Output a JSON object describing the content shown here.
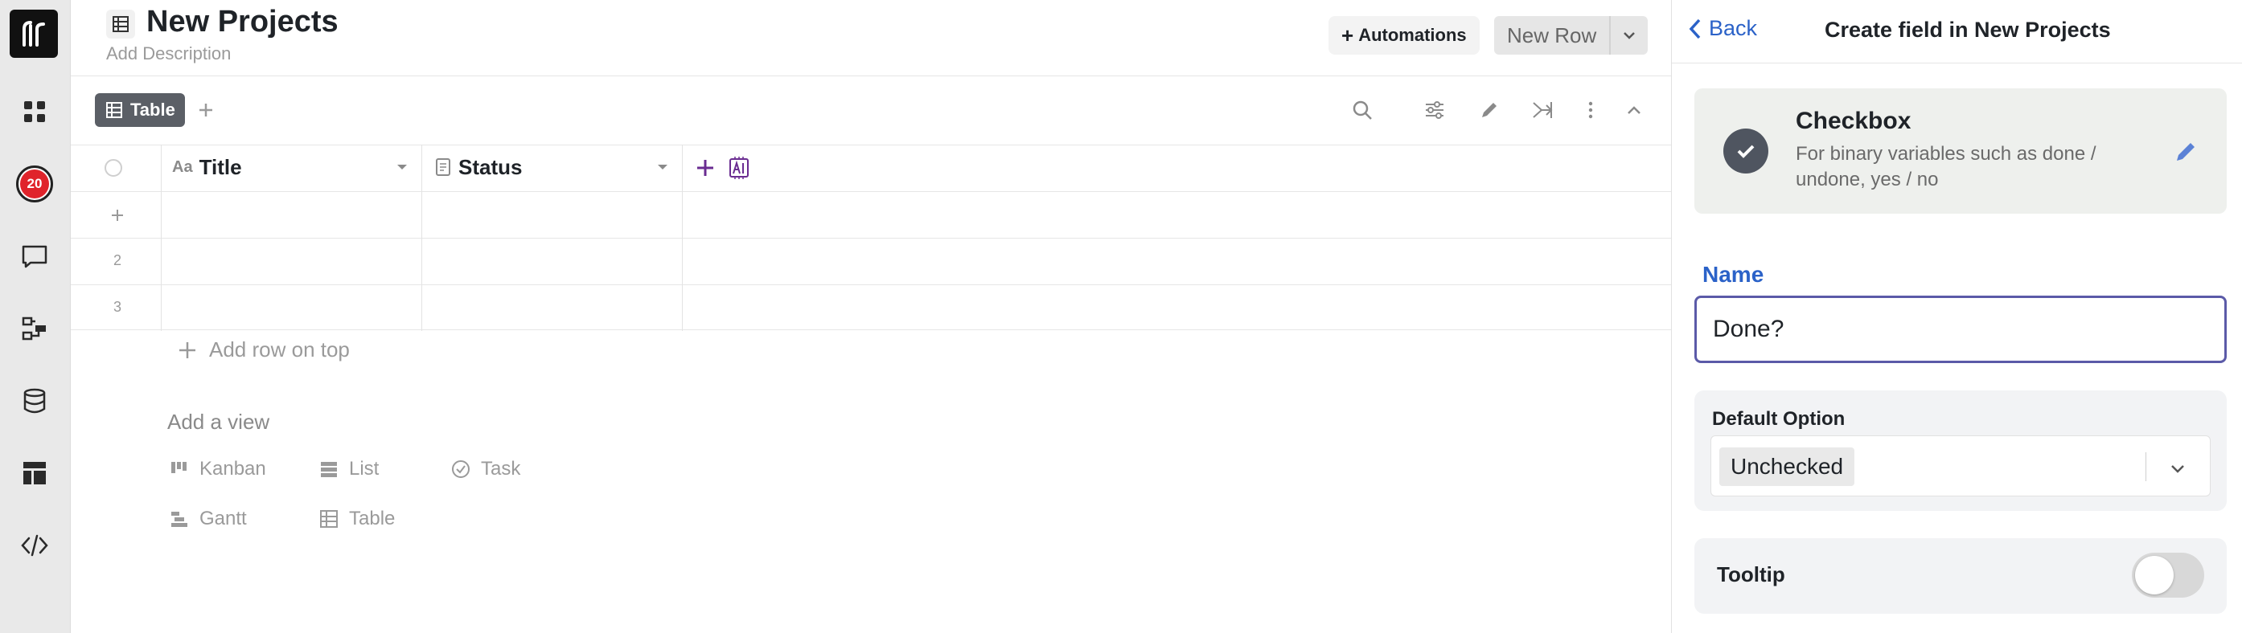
{
  "rail": {
    "notification_count": "20",
    "items": [
      "apps-grid",
      "notifications",
      "chat",
      "workflows",
      "database",
      "dashboards",
      "developer"
    ]
  },
  "header": {
    "title": "New Projects",
    "description_placeholder": "Add Description",
    "automations_label": "Automations",
    "new_row_label": "New Row"
  },
  "views": {
    "active_tab": "Table"
  },
  "grid": {
    "columns": [
      {
        "label": "Title",
        "type_icon": "Aa"
      },
      {
        "label": "Status",
        "type_icon": "document-icon"
      }
    ],
    "row_numbers": [
      "2",
      "3"
    ],
    "add_row_label": "Add row on top",
    "add_view_label": "Add a view",
    "view_options": [
      "Kanban",
      "List",
      "Task",
      "Gantt",
      "Table"
    ]
  },
  "panel": {
    "back_label": "Back",
    "title": "Create field in New Projects",
    "field_type": {
      "name": "Checkbox",
      "description": "For binary variables such as done / undone, yes / no"
    },
    "name_label": "Name",
    "name_value": "Done?",
    "default_option_label": "Default Option",
    "default_option_value": "Unchecked",
    "tooltip_label": "Tooltip",
    "tooltip_enabled": false
  },
  "colors": {
    "accent_blue": "#2b62c8",
    "input_focus": "#5b5aa8",
    "badge_red": "#e0242b",
    "ai_purple": "#6a2c91"
  }
}
